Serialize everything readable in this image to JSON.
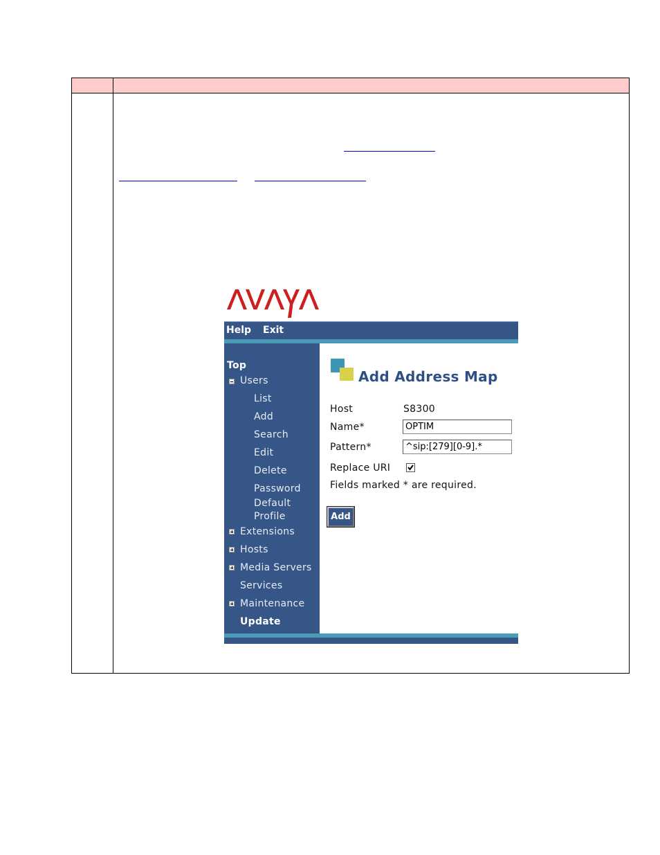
{
  "document": {
    "header_row": [
      "",
      ""
    ],
    "links": [
      "",
      "",
      ""
    ]
  },
  "brand": {
    "logo_text": "AVAYA",
    "logo_color": "#cc1f1f"
  },
  "topbar": {
    "help": "Help",
    "exit": "Exit"
  },
  "sidebar": {
    "top": "Top",
    "users": "Users",
    "users_children": [
      "List",
      "Add",
      "Search",
      "Edit",
      "Delete",
      "Password",
      "Default",
      "Profile"
    ],
    "extensions": "Extensions",
    "hosts": "Hosts",
    "media_servers": "Media Servers",
    "services": "Services",
    "maintenance": "Maintenance",
    "update": "Update"
  },
  "form": {
    "title": "Add Address Map",
    "host_label": "Host",
    "host_value": "S8300",
    "name_label": "Name*",
    "name_value": "OPTIM",
    "pattern_label": "Pattern*",
    "pattern_value": "^sip:[279][0-9].*",
    "replace_uri_label": "Replace URI",
    "replace_uri_checked": true,
    "required_note": "Fields marked * are required.",
    "add_button": "Add"
  },
  "colors": {
    "nav_blue": "#355687",
    "teal": "#4a9bb7",
    "header_pink": "#ffcccc",
    "title_blue": "#2e5087"
  }
}
